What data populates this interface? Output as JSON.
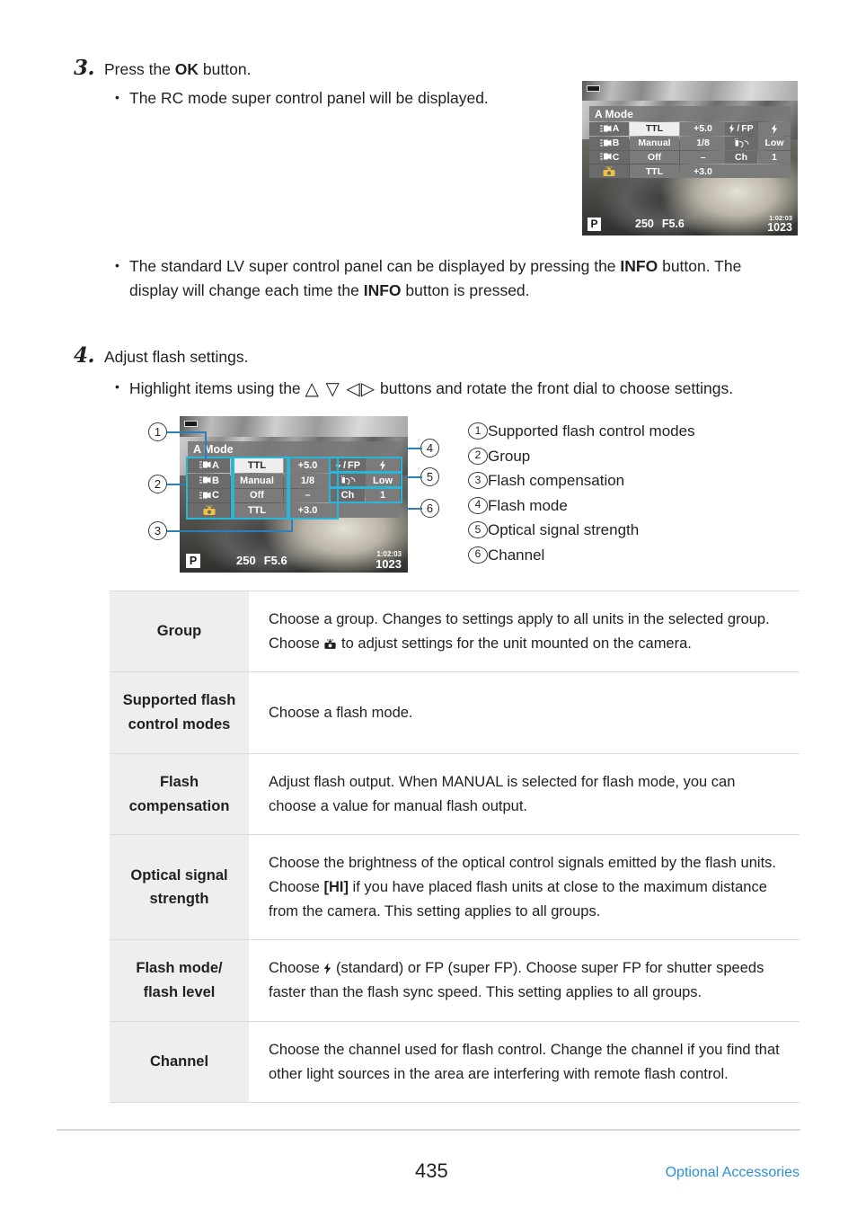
{
  "steps": [
    {
      "number": "3.",
      "text_before": "Press the ",
      "bold": "OK",
      "text_after": " button."
    },
    {
      "number": "4.",
      "text": "Adjust flash settings."
    }
  ],
  "bullets": {
    "b1": "The RC mode super control panel will be displayed.",
    "b2_part1": "The standard LV super control panel can be displayed by pressing the ",
    "b2_bold1": "INFO",
    "b2_part2": " button. The display will change each time the ",
    "b2_bold2": "INFO",
    "b2_part3": " button is pressed.",
    "b3_part1": "Highlight items using the ",
    "b3_arrows": "△ ▽ ◁▷",
    "b3_part2": " buttons and rotate the front dial to choose settings."
  },
  "lcd": {
    "mode_title": "A Mode",
    "rows": [
      {
        "group": "A",
        "mode": "TTL",
        "comp": "+5.0",
        "selected": true
      },
      {
        "group": "B",
        "mode": "Manual",
        "comp": "1/8",
        "selected": false
      },
      {
        "group": "C",
        "mode": "Off",
        "comp": "–",
        "selected": false
      },
      {
        "group": "camera",
        "mode": "TTL",
        "comp": "+3.0",
        "selected": false
      }
    ],
    "right": [
      {
        "label": "⚡ / FP",
        "value": "⚡"
      },
      {
        "label": "signal-icon",
        "value": "Low"
      },
      {
        "label": "Ch",
        "value": "1"
      }
    ],
    "bottom": {
      "mode_badge": "P",
      "shutter": "250",
      "aperture": "F5.6",
      "time": "1:02:03",
      "frames": "1023"
    }
  },
  "callouts": [
    {
      "num": "1",
      "label": "Supported flash control modes"
    },
    {
      "num": "2",
      "label": "Group"
    },
    {
      "num": "3",
      "label": "Flash compensation"
    },
    {
      "num": "4",
      "label": "Flash mode"
    },
    {
      "num": "5",
      "label": "Optical signal strength"
    },
    {
      "num": "6",
      "label": "Channel"
    }
  ],
  "table": {
    "rows": [
      {
        "key": "Group",
        "value_p1": "Choose a group. Changes to settings apply to all units in the selected group. Choose ",
        "icon": "camera-flash-icon",
        "value_p2": " to adjust settings for the unit mounted on the camera."
      },
      {
        "key": "Supported flash control modes",
        "value_p1": "Choose a flash mode.",
        "icon": "",
        "value_p2": ""
      },
      {
        "key": "Flash compensation",
        "value_p1": "Adjust flash output. When MANUAL is selected for flash mode, you can choose a value for manual flash output.",
        "icon": "",
        "value_p2": ""
      },
      {
        "key": "Optical signal strength",
        "value_p1": "Choose the brightness of the optical control signals emitted by the flash units. Choose ",
        "bold": "[HI]",
        "value_p2": " if you have placed flash units at close to the maximum distance from the camera. This setting applies to all groups."
      },
      {
        "key": "Flash mode/ flash level",
        "value_p1": "Choose ",
        "icon": "flash-bolt-icon",
        "value_p2": " (standard) or FP (super FP). Choose super FP for shutter speeds faster than the flash sync speed. This setting applies to all groups."
      },
      {
        "key": "Channel",
        "value_p1": "Choose the channel used for flash control. Change the channel if you find that other light sources in the area are interfering with remote flash control.",
        "icon": "",
        "value_p2": ""
      }
    ]
  },
  "footer": {
    "page_number": "435",
    "section": "Optional Accessories",
    "accent_color": "#2b8fd6"
  }
}
